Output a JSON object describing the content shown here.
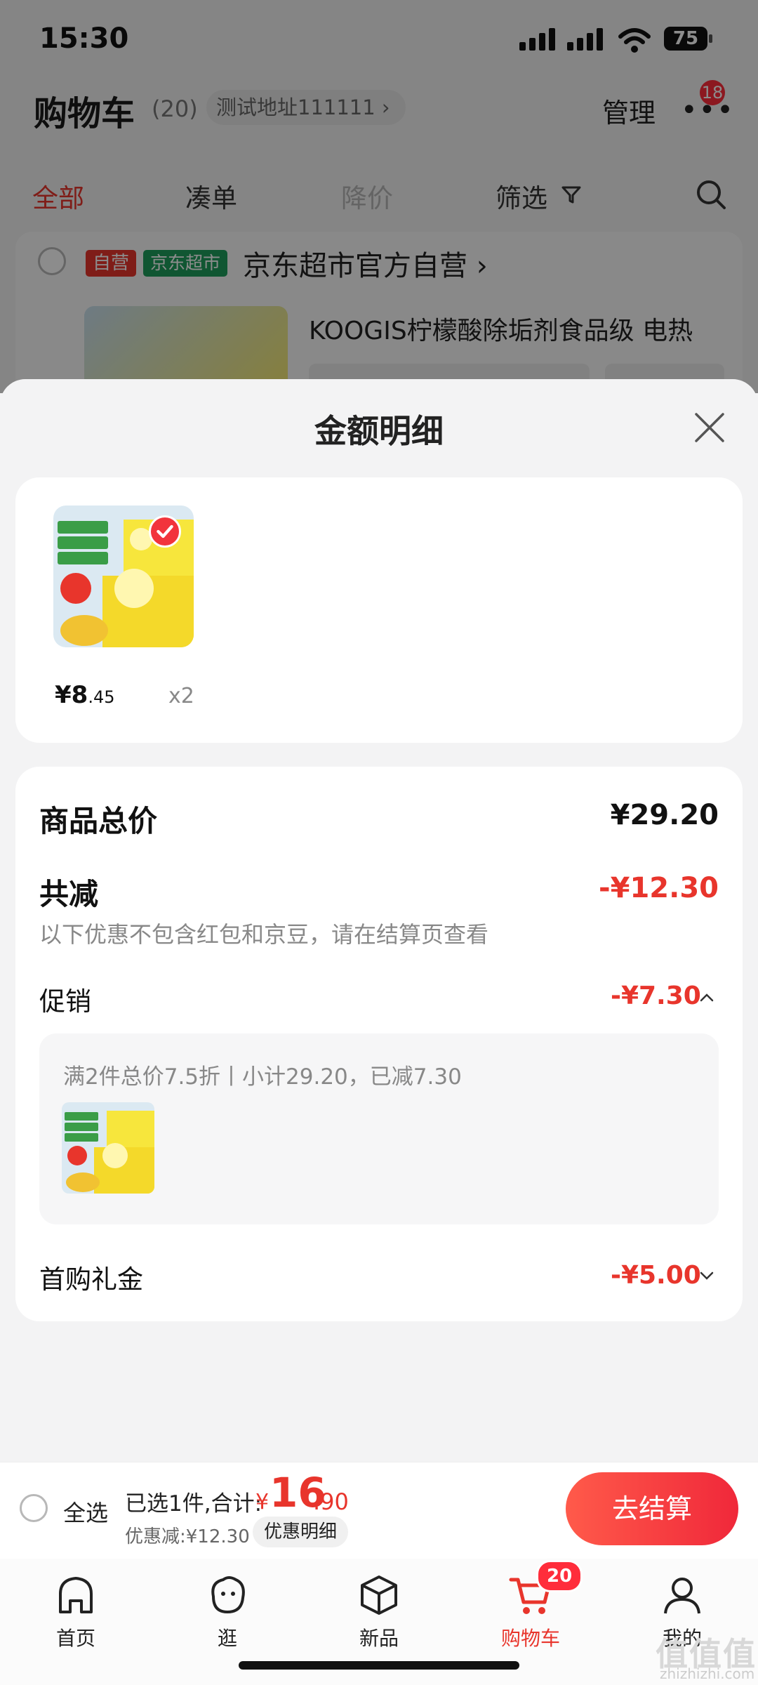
{
  "status_bar": {
    "time": "15:30",
    "battery": "75"
  },
  "cart_header": {
    "title": "购物车",
    "count": "(20)",
    "address": "测试地址111111 ›",
    "manage": "管理",
    "more": "•••",
    "message_badge": "18"
  },
  "filter_tabs": {
    "all": "全部",
    "bundle": "凑单",
    "price_drop": "降价",
    "filter": "筛选"
  },
  "store": {
    "tag_ziying": "自营",
    "tag_market": "京东超市",
    "name": "京东超市官方自营 ›",
    "product_title": "KOOGIS柠檬酸除垢剂食品级 电热"
  },
  "sheet": {
    "title": "金额明细",
    "item": {
      "price_int": "¥8",
      "price_dec": ".45",
      "qty": "x2"
    },
    "total_label": "商品总价",
    "total_value": "¥29.20",
    "reduce_label": "共减",
    "reduce_value": "-¥12.30",
    "reduce_note": "以下优惠不包含红包和京豆，请在结算页查看",
    "promo_label": "促销",
    "promo_value": "-¥7.30",
    "promo_detail": "满2件总价7.5折丨小计29.20，已减7.30",
    "first_gift_label": "首购礼金",
    "first_gift_value": "-¥5.00"
  },
  "checkout": {
    "select_all": "全选",
    "selected_info": "已选1件,合计:",
    "currency": "¥",
    "total_int": "16",
    "total_dec": ".90",
    "discount": "优惠减:¥12.30",
    "detail_chip": "优惠明细",
    "button": "去结算"
  },
  "bottom_nav": {
    "items": [
      {
        "label": "首页",
        "icon": "home-icon"
      },
      {
        "label": "逛",
        "icon": "browse-icon"
      },
      {
        "label": "新品",
        "icon": "cube-icon"
      },
      {
        "label": "购物车",
        "icon": "cart-icon"
      },
      {
        "label": "我的",
        "icon": "user-icon"
      }
    ],
    "cart_badge": "20"
  },
  "watermark": {
    "main": "值值值",
    "sub": "zhizhizhi.com"
  },
  "colors": {
    "accent_red": "#e8352c",
    "green_tag": "#1e9d5b"
  }
}
